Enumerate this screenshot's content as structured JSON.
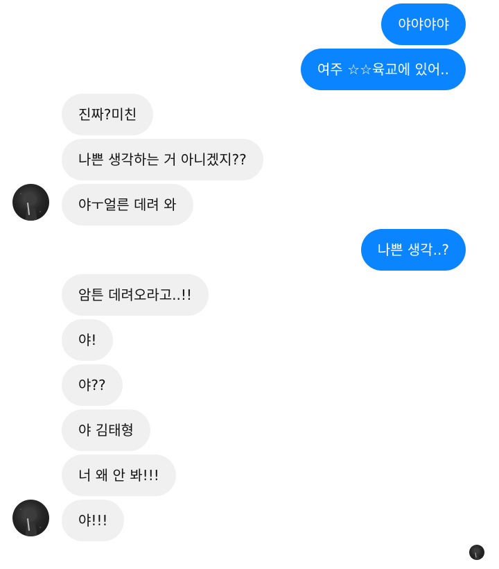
{
  "conversation": {
    "messages": [
      {
        "id": "m1",
        "direction": "sent",
        "text": "야야야야"
      },
      {
        "id": "m2",
        "direction": "sent",
        "text": "여주 ☆☆육교에 있어.."
      },
      {
        "id": "m3",
        "direction": "received",
        "text": "진짜?미친"
      },
      {
        "id": "m4",
        "direction": "received",
        "text": "나쁜 생각하는 거 아니겠지??"
      },
      {
        "id": "m5",
        "direction": "received",
        "text": "야ㅜ얼른 데려 와"
      },
      {
        "id": "m6",
        "direction": "sent",
        "text": "나쁜 생각..?"
      },
      {
        "id": "m7",
        "direction": "received",
        "text": "암튼 데려오라고..!!"
      },
      {
        "id": "m8",
        "direction": "received",
        "text": "야!"
      },
      {
        "id": "m9",
        "direction": "received",
        "text": "야??"
      },
      {
        "id": "m10",
        "direction": "received",
        "text": "야 김태형"
      },
      {
        "id": "m11",
        "direction": "received",
        "text": "너 왜 안 봐!!!"
      },
      {
        "id": "m12",
        "direction": "received",
        "text": "야!!!"
      }
    ]
  },
  "colors": {
    "sent_bubble": "#0a84ff",
    "sent_text": "#ffffff",
    "received_bubble": "#f0f0f0",
    "received_text": "#111111"
  },
  "icons": {
    "contact_avatar": "contact-avatar",
    "read_receipt": "read-receipt-avatar"
  }
}
